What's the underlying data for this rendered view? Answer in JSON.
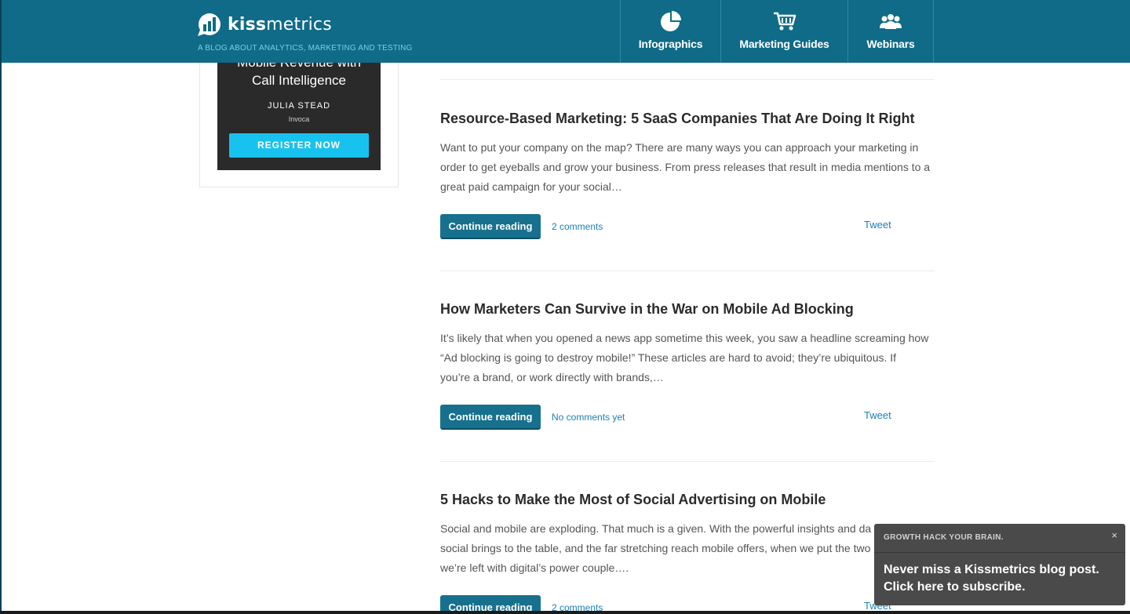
{
  "colors": {
    "header_bg": "#0f6b87",
    "tagline": "#76cfe9",
    "button_bg": "#17708d",
    "link": "#1a7fb6",
    "ad_button": "#18c2ee",
    "popup_bg": "#4a4a4a"
  },
  "header": {
    "logo_bold": "kiss",
    "logo_light": "metrics",
    "logo_icon": "bar-chart-bubble-icon",
    "tagline": "A BLOG ABOUT ANALYTICS, MARKETING AND TESTING",
    "nav": [
      {
        "label": "Infographics",
        "icon": "pie-chart-icon"
      },
      {
        "label": "Marketing Guides",
        "icon": "shopping-cart-icon"
      },
      {
        "label": "Webinars",
        "icon": "people-icon"
      }
    ]
  },
  "ad": {
    "title_line1": "Mobile Revenue with",
    "title_line2": "Call Intelligence",
    "author": "JULIA STEAD",
    "company": "Invoca",
    "button": "REGISTER NOW"
  },
  "posts": [
    {
      "title": "Resource-Based Marketing: 5 SaaS Companies That Are Doing It Right",
      "excerpt_lines": [
        "Want to put your company on the map? There are many ways you can approach your marketing in",
        "order to get eyeballs and grow your business. From press releases that result in media mentions to a",
        "great paid campaign for your social…"
      ],
      "continue": "Continue reading",
      "comments": "2 comments",
      "tweet": "Tweet"
    },
    {
      "title": "How Marketers Can Survive in the War on Mobile Ad Blocking",
      "excerpt_lines": [
        "It’s likely that when you opened a news app sometime this week, you saw a headline screaming how",
        "“Ad blocking is going to destroy mobile!” These articles are hard to avoid; they’re ubiquitous. If",
        "you’re a brand, or work directly with brands,…"
      ],
      "continue": "Continue reading",
      "comments": "No comments yet",
      "tweet": "Tweet"
    },
    {
      "title": "5 Hacks to Make the Most of Social Advertising on Mobile",
      "excerpt_lines": [
        "Social and mobile are exploding. That much is a given. With the powerful insights and da",
        "social brings to the table, and the far stretching reach mobile offers, when we put the two",
        "we’re left with digital’s power couple…."
      ],
      "continue": "Continue reading",
      "comments": "2 comments",
      "tweet": "Tweet"
    }
  ],
  "popup": {
    "kicker": "GROWTH HACK YOUR BRAIN.",
    "close": "×",
    "line1": "Never miss a Kissmetrics blog post.",
    "line2": "Click here to subscribe."
  }
}
